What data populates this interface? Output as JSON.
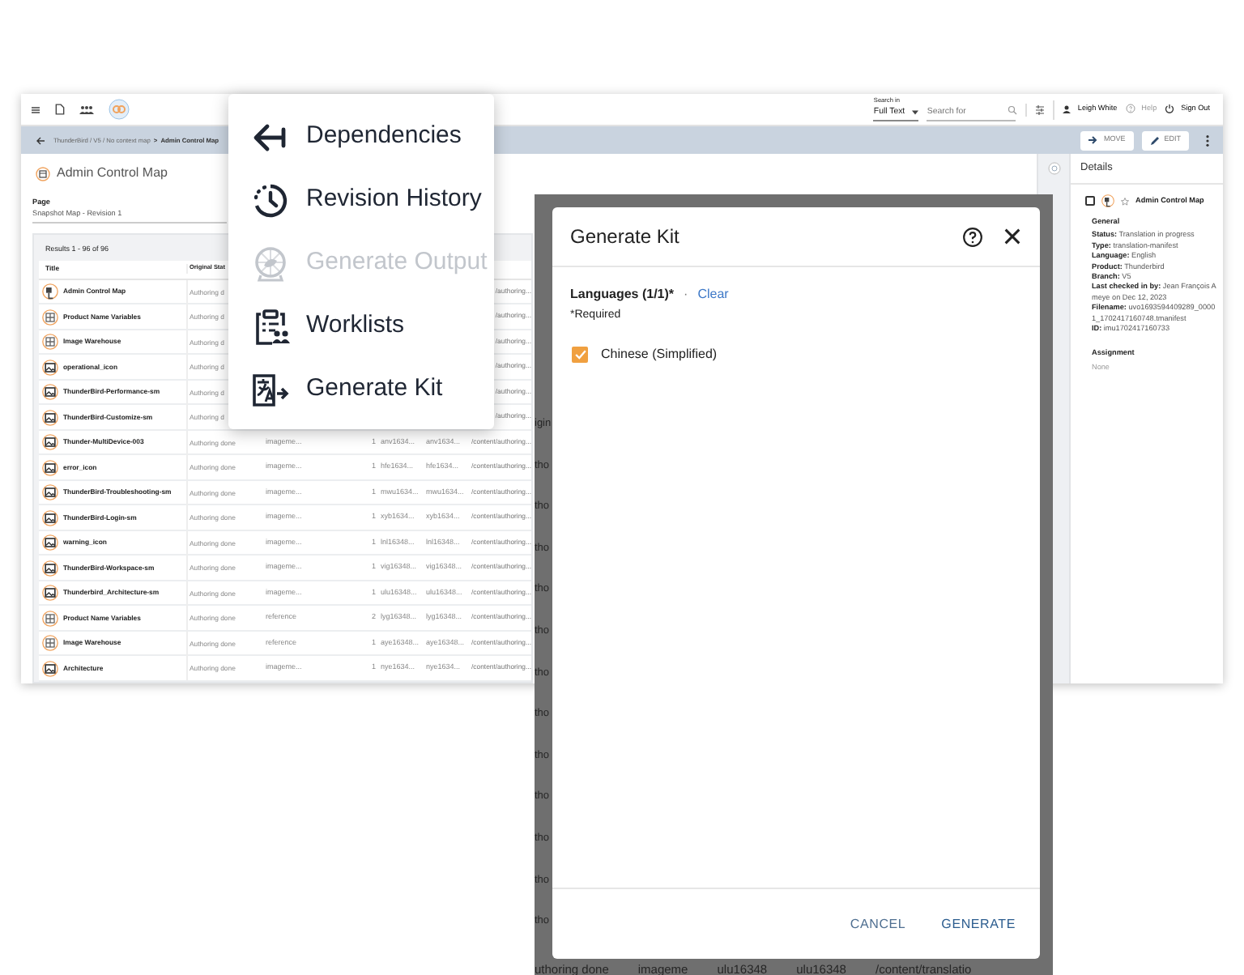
{
  "app_window": {
    "top_bar": {
      "search_in_label": "Search in",
      "search_scope": "Full Text",
      "search_placeholder": "Search for",
      "user": "Leigh White",
      "help": {
        "label": "Help",
        "disabled": true
      },
      "sign_out": "Sign Out"
    },
    "breadcrumb": {
      "path": "ThunderBird / V5 / No context map",
      "separator": ">",
      "current": "Admin Control Map"
    },
    "toolbar_buttons": [
      {
        "kind": "move",
        "label": "MOVE"
      },
      {
        "kind": "edit",
        "label": "EDIT"
      }
    ],
    "page_title": "Admin Control Map",
    "page_label": "Page",
    "page_value": "Snapshot Map - Revision 1",
    "table": {
      "results": "Results 1 - 96 of 96",
      "columns": [
        "Title",
        "Original Stat"
      ],
      "rows": [
        {
          "kind": "map",
          "title": "Admin Control Map",
          "status": "Authoring d",
          "path": "/authoring..."
        },
        {
          "kind": "grid",
          "title": "Product Name Variables",
          "status": "Authoring d",
          "path": "/authoring..."
        },
        {
          "kind": "grid",
          "title": "Image Warehouse",
          "status": "Authoring d",
          "path": "/authoring..."
        },
        {
          "kind": "image",
          "title": "operational_icon",
          "status": "Authoring d",
          "path": "/authoring..."
        },
        {
          "kind": "image",
          "title": "ThunderBird-Performance-sm",
          "status": "Authoring d",
          "path": "/authoring..."
        },
        {
          "kind": "image",
          "title": "ThunderBird-Customize-sm",
          "status": "Authoring d",
          "path": "/authoring..."
        },
        {
          "kind": "image",
          "title": "Thunder-MultiDevice-003",
          "status": "Authoring done",
          "type": "imageme...",
          "count": "1",
          "id": "anv1634...",
          "id2": "anv1634...",
          "path": "/content/authoring..."
        },
        {
          "kind": "image",
          "title": "error_icon",
          "status": "Authoring done",
          "type": "imageme...",
          "count": "1",
          "id": "hfe1634...",
          "id2": "hfe1634...",
          "path": "/content/authoring..."
        },
        {
          "kind": "image",
          "title": "ThunderBird-Troubleshooting-sm",
          "status": "Authoring done",
          "type": "imageme...",
          "count": "1",
          "id": "mwu1634...",
          "id2": "mwu1634...",
          "path": "/content/authoring..."
        },
        {
          "kind": "image",
          "title": "ThunderBird-Login-sm",
          "status": "Authoring done",
          "type": "imageme...",
          "count": "1",
          "id": "xyb1634...",
          "id2": "xyb1634...",
          "path": "/content/authoring..."
        },
        {
          "kind": "image",
          "title": "warning_icon",
          "status": "Authoring done",
          "type": "imageme...",
          "count": "1",
          "id": "lnl16348...",
          "id2": "lnl16348...",
          "path": "/content/authoring..."
        },
        {
          "kind": "image",
          "title": "ThunderBird-Workspace-sm",
          "status": "Authoring done",
          "type": "imageme...",
          "count": "1",
          "id": "vig16348...",
          "id2": "vig16348...",
          "path": "/content/authoring..."
        },
        {
          "kind": "image",
          "title": "Thunderbird_Architecture-sm",
          "status": "Authoring done",
          "type": "imageme...",
          "count": "1",
          "id": "ulu16348...",
          "id2": "ulu16348...",
          "path": "/content/authoring..."
        },
        {
          "kind": "grid",
          "title": "Product Name Variables",
          "status": "Authoring done",
          "type": "reference",
          "count": "2",
          "id": "lyg16348...",
          "id2": "lyg16348...",
          "path": "/content/authoring..."
        },
        {
          "kind": "grid",
          "title": "Image Warehouse",
          "status": "Authoring done",
          "type": "reference",
          "count": "1",
          "id": "aye16348...",
          "id2": "aye16348...",
          "path": "/content/authoring..."
        },
        {
          "kind": "image",
          "title": "Architecture",
          "status": "Authoring done",
          "type": "imageme...",
          "count": "1",
          "id": "nye1634...",
          "id2": "nye1634...",
          "path": "/content/authoring..."
        }
      ]
    },
    "details": {
      "title": "Details",
      "item": {
        "title": "Admin Control Map",
        "checked": false,
        "starred": false
      },
      "section": "General",
      "fields": [
        {
          "label": "Status:",
          "value": "Translation in progress"
        },
        {
          "label": "Type:",
          "value": "translation-manifest"
        },
        {
          "label": "Language:",
          "value": "English"
        },
        {
          "label": "Product:",
          "value": "Thunderbird"
        },
        {
          "label": "Branch:",
          "value": "V5"
        },
        {
          "label": "Last checked in by:",
          "value": "Jean François Ameye on Dec 12, 2023"
        },
        {
          "label": "Filename:",
          "value": "uvo1693594409289_00001_1702417160748.tmanifest"
        },
        {
          "label": "ID:",
          "value": "imu1702417160733"
        }
      ],
      "assignment_label": "Assignment",
      "assignment_value": "None"
    }
  },
  "menu": {
    "items": [
      {
        "kind": "dependencies",
        "label": "Dependencies",
        "disabled": false
      },
      {
        "kind": "history",
        "label": "Revision History",
        "disabled": false
      },
      {
        "kind": "output",
        "label": "Generate Output",
        "disabled": true
      },
      {
        "kind": "worklists",
        "label": "Worklists",
        "disabled": false
      },
      {
        "kind": "kit",
        "label": "Generate Kit",
        "disabled": false
      }
    ]
  },
  "backdrop": {
    "fragments": [
      "igin",
      "tho",
      "tho",
      "tho",
      "tho",
      "tho",
      "tho",
      "tho",
      "tho",
      "tho",
      "tho",
      "tho",
      "tho"
    ],
    "bottom_row": [
      "uthoring done",
      "imageme",
      "ulu16348",
      "ulu16348",
      "/content/translatio"
    ]
  },
  "dialog": {
    "title": "Generate Kit",
    "field_label": "Languages (1/1)*",
    "separator": "·",
    "clear": "Clear",
    "required_note": "*Required",
    "options": [
      {
        "label": "Chinese (Simplified)",
        "checked": true
      }
    ],
    "buttons": [
      {
        "kind": "cancel",
        "label": "CANCEL"
      },
      {
        "kind": "primary",
        "label": "GENERATE"
      }
    ]
  }
}
